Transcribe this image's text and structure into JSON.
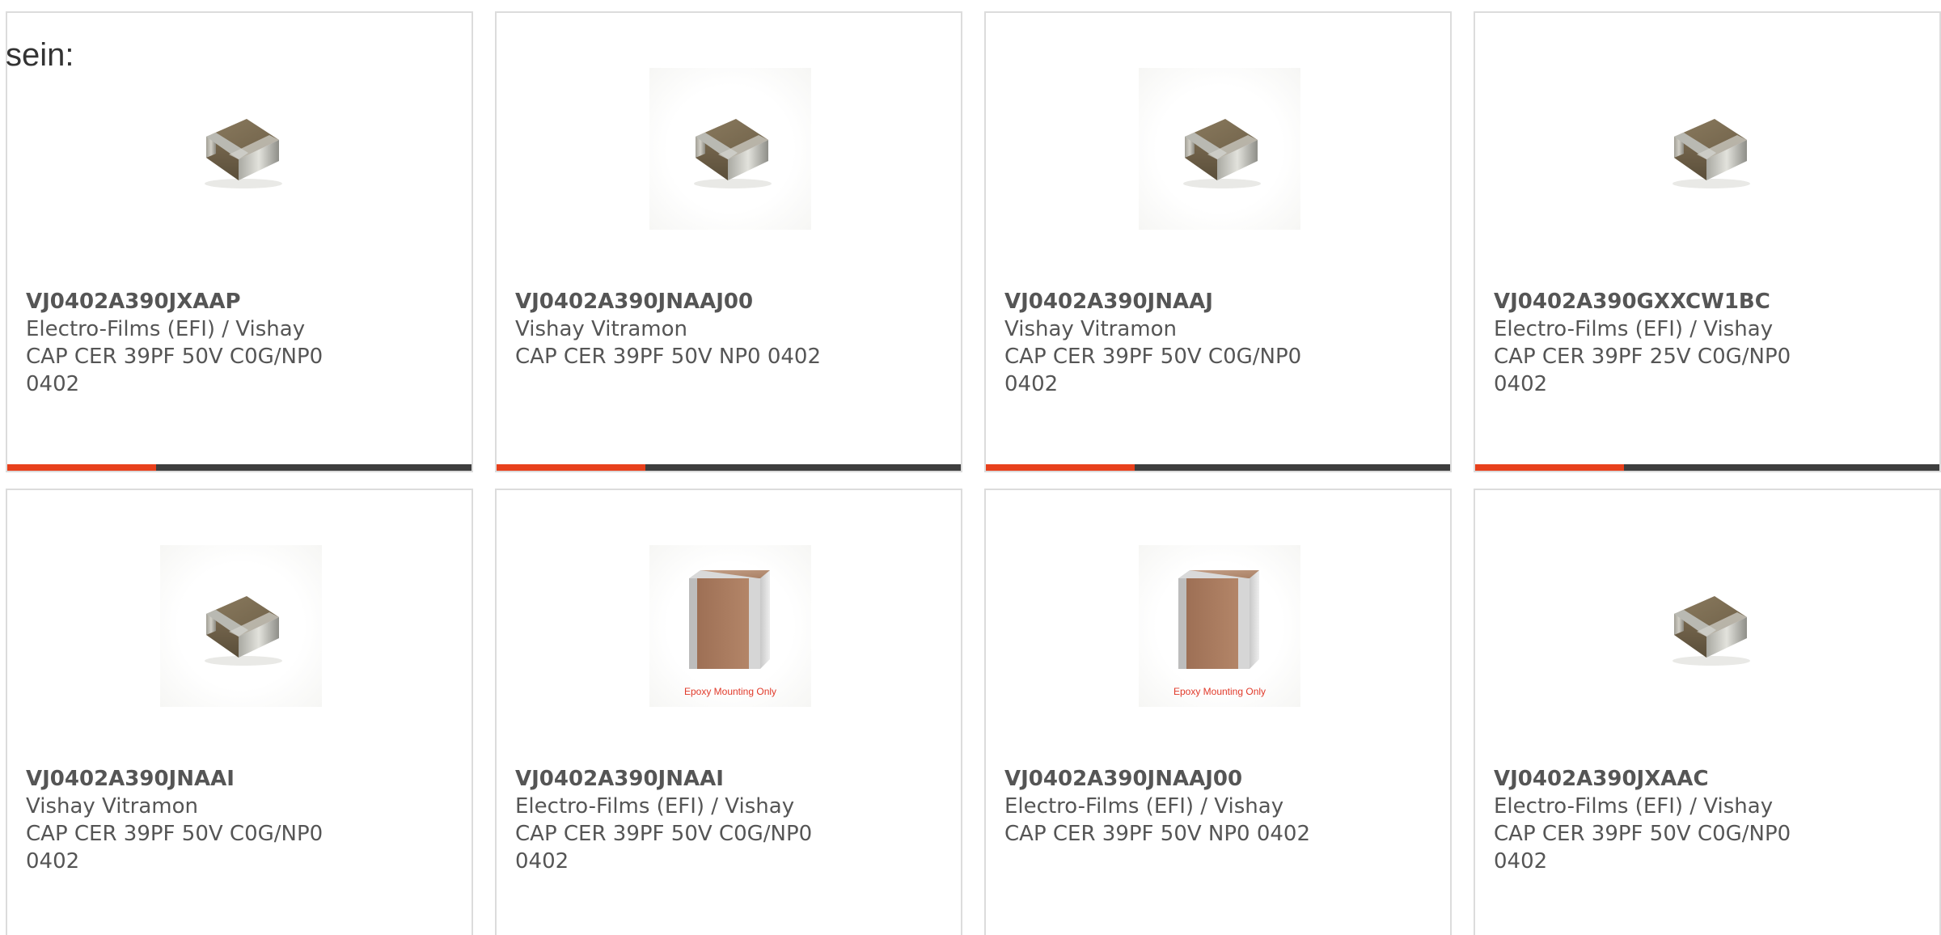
{
  "heading": "sein:",
  "colors": {
    "accent": "#e8401c",
    "bar_track": "#3e3e3e",
    "card_border": "#dcdcdc",
    "text": "#555555",
    "epoxy_note": "#e13a2a"
  },
  "cards": [
    {
      "part_number": "VJ0402A390JXAAP",
      "manufacturer": "Electro-Films (EFI) / Vishay",
      "description": "CAP CER 39PF 50V C0G/NP0 0402",
      "image": "chip-capacitor-small",
      "image_note": "",
      "progress": 0.32
    },
    {
      "part_number": "VJ0402A390JNAAJ00",
      "manufacturer": "Vishay Vitramon",
      "description": "CAP CER 39PF 50V NP0 0402",
      "image": "chip-capacitor-small",
      "image_note": "",
      "progress": 0.32
    },
    {
      "part_number": "VJ0402A390JNAAJ",
      "manufacturer": "Vishay Vitramon",
      "description": "CAP CER 39PF 50V C0G/NP0 0402",
      "image": "chip-capacitor-small",
      "image_note": "",
      "progress": 0.32
    },
    {
      "part_number": "VJ0402A390GXXCW1BC",
      "manufacturer": "Electro-Films (EFI) / Vishay",
      "description": "CAP CER 39PF 25V C0G/NP0 0402",
      "image": "chip-capacitor-small",
      "image_note": "",
      "progress": 0.32
    },
    {
      "part_number": "VJ0402A390JNAAI",
      "manufacturer": "Vishay Vitramon",
      "description": "CAP CER 39PF 50V C0G/NP0 0402",
      "image": "chip-capacitor-small",
      "image_note": "",
      "progress": null
    },
    {
      "part_number": "VJ0402A390JNAAI",
      "manufacturer": "Electro-Films (EFI) / Vishay",
      "description": "CAP CER 39PF 50V C0G/NP0 0402",
      "image": "chip-capacitor-large",
      "image_note": "Epoxy Mounting Only",
      "progress": null
    },
    {
      "part_number": "VJ0402A390JNAAJ00",
      "manufacturer": "Electro-Films (EFI) / Vishay",
      "description": "CAP CER 39PF 50V NP0 0402",
      "image": "chip-capacitor-large",
      "image_note": "Epoxy Mounting Only",
      "progress": null
    },
    {
      "part_number": "VJ0402A390JXAAC",
      "manufacturer": "Electro-Films (EFI) / Vishay",
      "description": "CAP CER 39PF 50V C0G/NP0 0402",
      "image": "chip-capacitor-small",
      "image_note": "",
      "progress": null
    }
  ]
}
